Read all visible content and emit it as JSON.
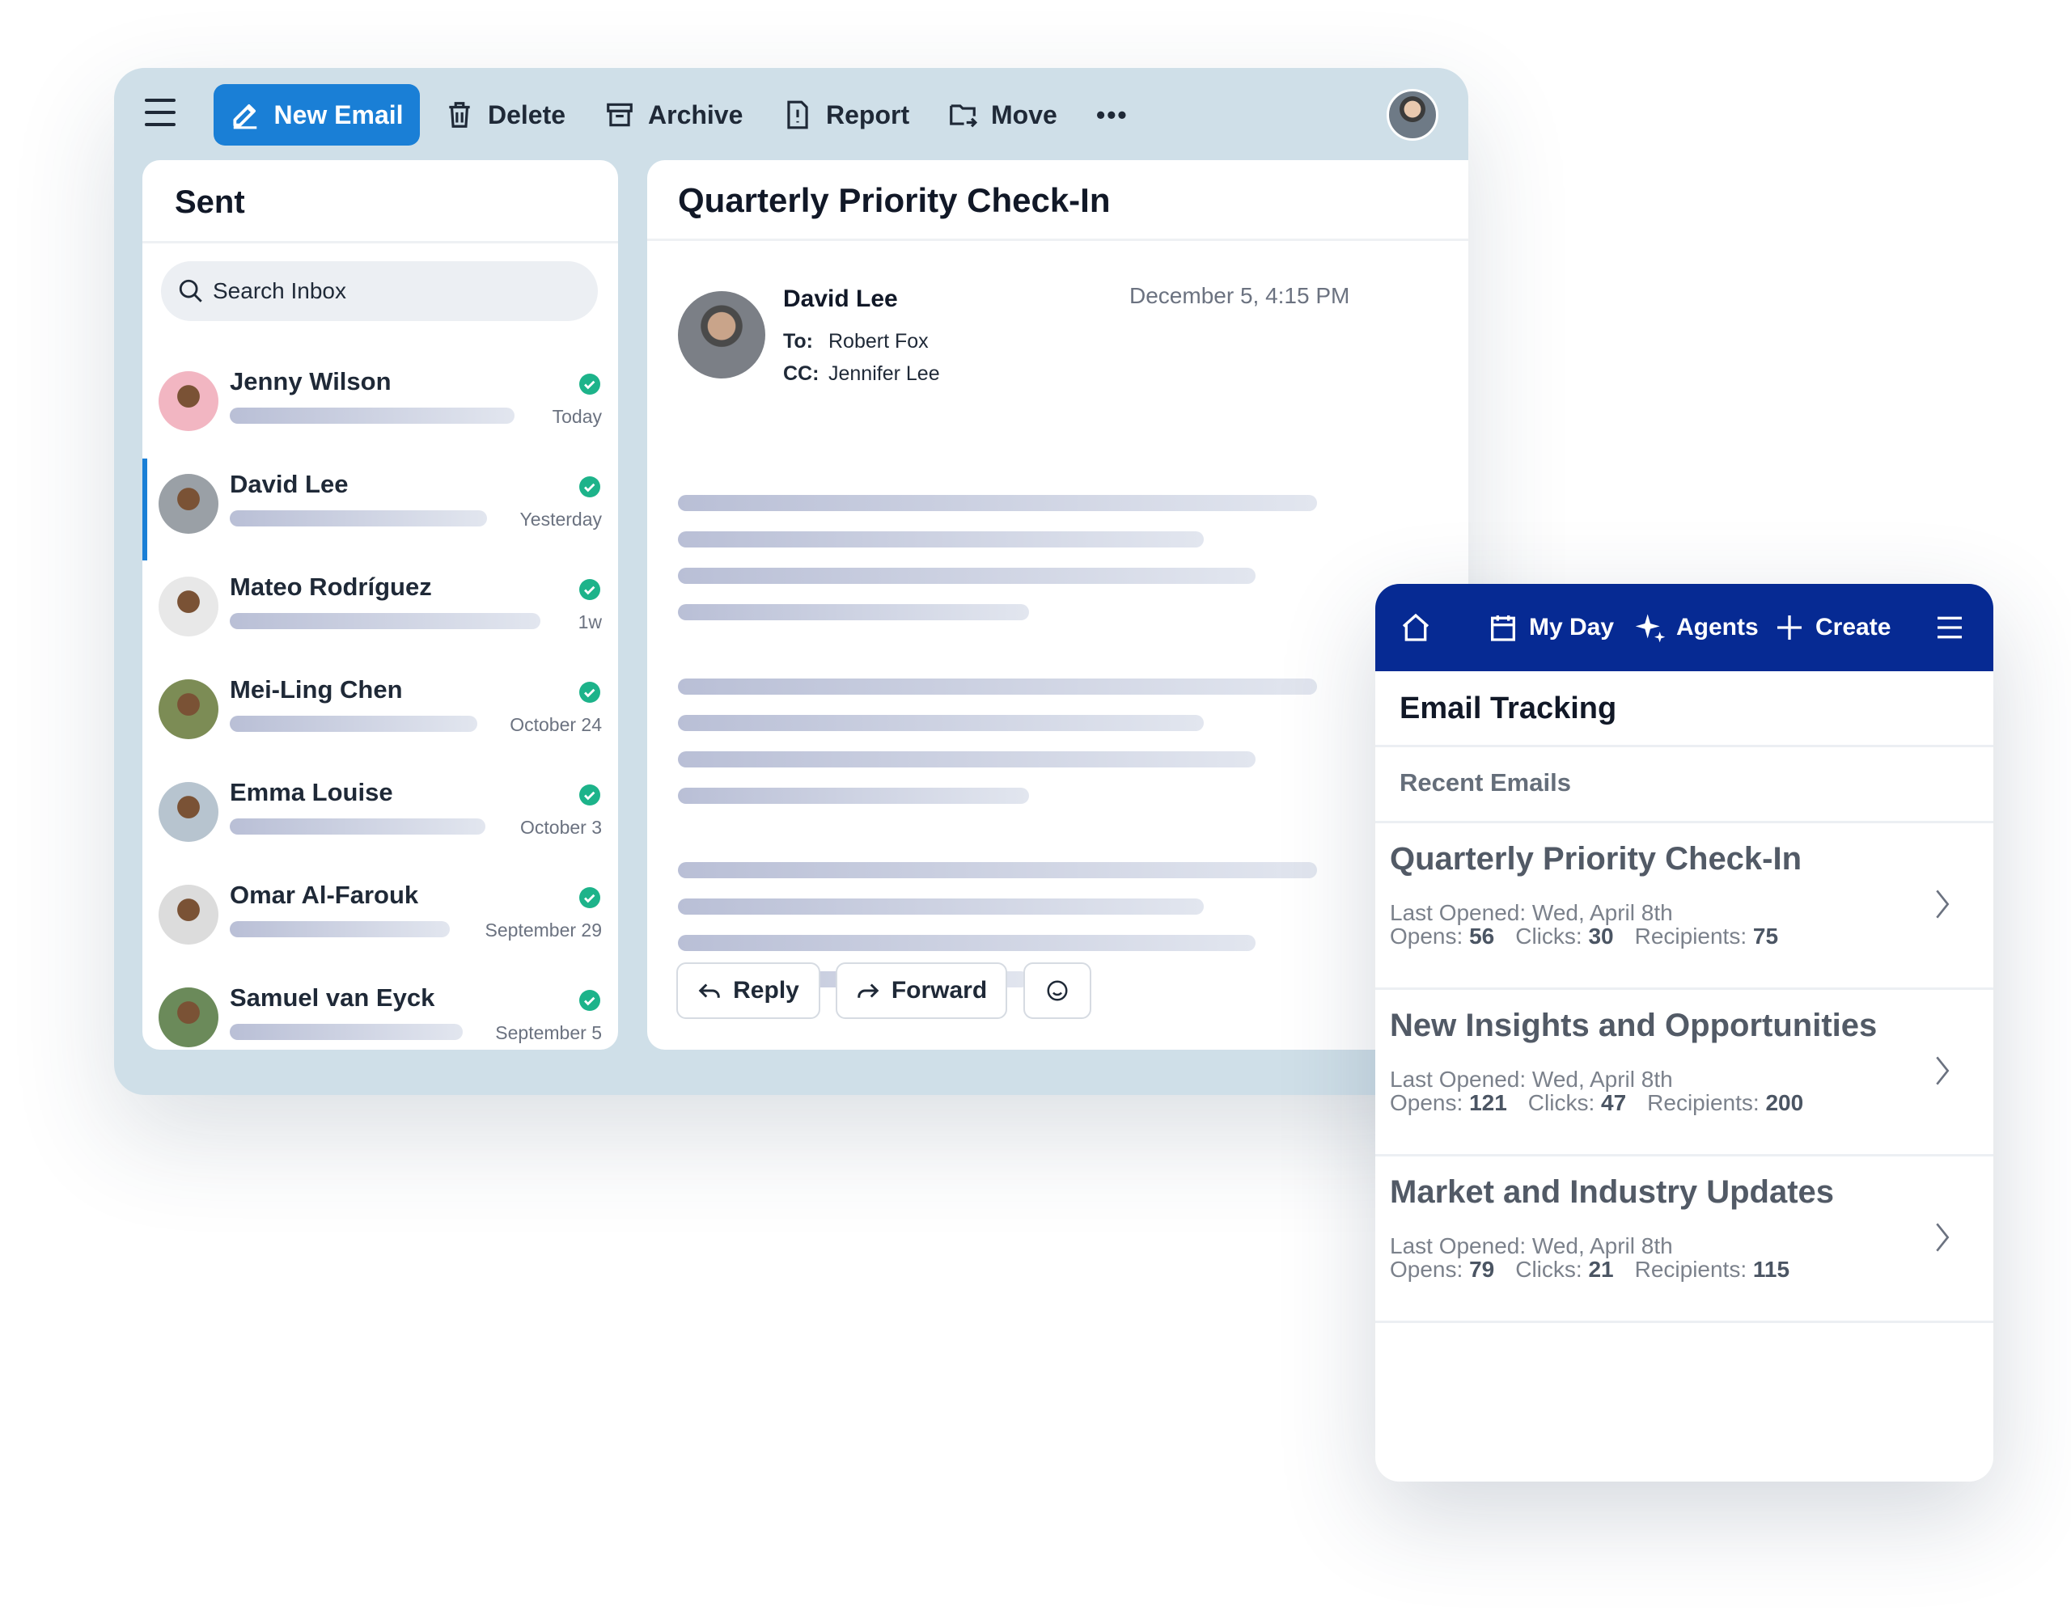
{
  "toolbar": {
    "new_email": "New Email",
    "delete": "Delete",
    "archive": "Archive",
    "report": "Report",
    "move": "Move",
    "more": "•••"
  },
  "list": {
    "title": "Sent",
    "search_placeholder": "Search Inbox",
    "items": [
      {
        "name": "Jenny Wilson",
        "date": "Today",
        "selected": false,
        "avatar_color": "#f2b6c2"
      },
      {
        "name": "David Lee",
        "date": "Yesterday",
        "selected": true,
        "avatar_color": "#9aa0a6"
      },
      {
        "name": "Mateo Rodríguez",
        "date": "1w",
        "selected": false,
        "avatar_color": "#e8e8e8"
      },
      {
        "name": "Mei-Ling Chen",
        "date": "October 24",
        "selected": false,
        "avatar_color": "#7c8c55"
      },
      {
        "name": "Emma Louise",
        "date": "October 3",
        "selected": false,
        "avatar_color": "#b7c4cf"
      },
      {
        "name": "Omar Al-Farouk",
        "date": "September 29",
        "selected": false,
        "avatar_color": "#dcdcdc"
      },
      {
        "name": "Samuel van Eyck",
        "date": "September 5",
        "selected": false,
        "avatar_color": "#6b8a5a"
      }
    ]
  },
  "email": {
    "subject": "Quarterly Priority Check-In",
    "sender": "David Lee",
    "date": "December 5, 4:15 PM",
    "to_label": "To:",
    "to": "Robert Fox",
    "cc_label": "CC:",
    "cc": "Jennifer Lee",
    "reply": "Reply",
    "forward": "Forward"
  },
  "mobile": {
    "nav": {
      "my_day": "My Day",
      "agents": "Agents",
      "create": "Create"
    },
    "title": "Email Tracking",
    "section": "Recent Emails",
    "opens_label": "Opens:",
    "clicks_label": "Clicks:",
    "recipients_label": "Recipients:",
    "items": [
      {
        "title": "Quarterly Priority Check-In",
        "last_opened": "Last Opened: Wed, April 8th",
        "opens": "56",
        "clicks": "30",
        "recipients": "75"
      },
      {
        "title": "New Insights and Opportunities",
        "last_opened": "Last Opened: Wed, April 8th",
        "opens": "121",
        "clicks": "47",
        "recipients": "200"
      },
      {
        "title": "Market and Industry Updates",
        "last_opened": "Last Opened: Wed, April 8th",
        "opens": "79",
        "clicks": "21",
        "recipients": "115"
      }
    ]
  },
  "colors": {
    "accent": "#1a7fd6",
    "nav": "#062a93",
    "check": "#1db38a"
  }
}
